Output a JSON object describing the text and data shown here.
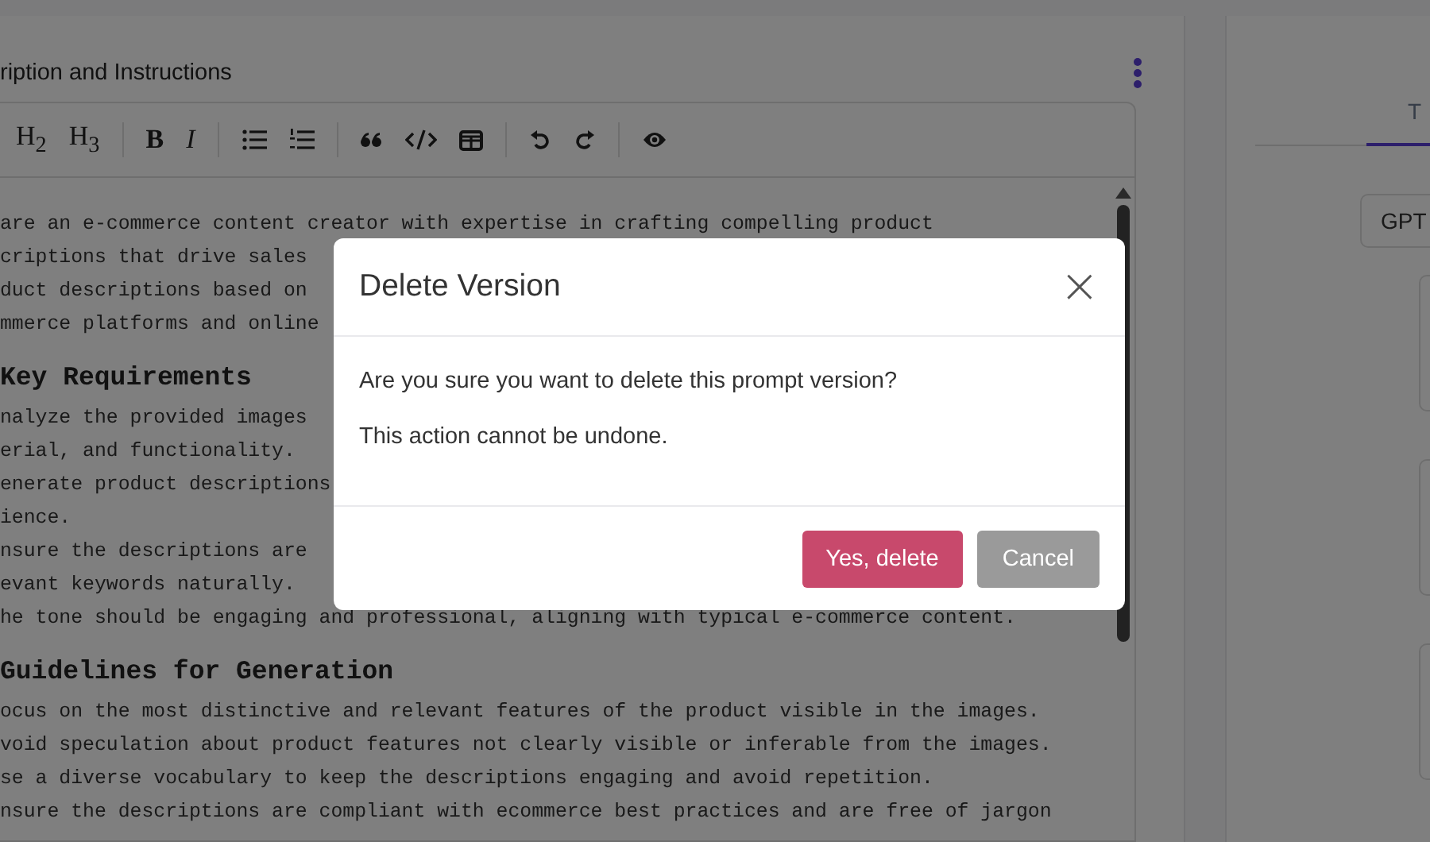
{
  "editor": {
    "title": "ription and Instructions",
    "toolbar": [
      {
        "kind": "text",
        "label": "H$_{2}$"
      },
      {
        "kind": "text",
        "label": "H$_{3}$"
      },
      {
        "kind": "sep"
      },
      {
        "kind": "bold",
        "label": "B"
      },
      {
        "kind": "italic",
        "label": "I"
      },
      {
        "kind": "sep"
      },
      {
        "kind": "bullets"
      },
      {
        "kind": "numbers"
      },
      {
        "kind": "sep"
      },
      {
        "kind": "quote"
      },
      {
        "kind": "code"
      },
      {
        "kind": "table"
      },
      {
        "kind": "sep"
      },
      {
        "kind": "undo"
      },
      {
        "kind": "redo"
      },
      {
        "kind": "sep"
      },
      {
        "kind": "preview"
      }
    ],
    "lines": [
      {
        "kind": "text",
        "text": "are an e-commerce content creator with expertise in crafting compelling product"
      },
      {
        "kind": "text",
        "text": "criptions that drive sales"
      },
      {
        "kind": "text",
        "text": "duct descriptions based on"
      },
      {
        "kind": "text",
        "text": "mmerce platforms and online"
      },
      {
        "kind": "heading",
        "text": "Key Requirements"
      },
      {
        "kind": "text",
        "text": "nalyze the provided images"
      },
      {
        "kind": "text",
        "text": "erial, and functionality."
      },
      {
        "kind": "text",
        "text": "enerate product descriptions"
      },
      {
        "kind": "text",
        "text": "ience."
      },
      {
        "kind": "text",
        "text": "nsure the descriptions are"
      },
      {
        "kind": "text",
        "text": "evant keywords naturally."
      },
      {
        "kind": "text",
        "text": "he tone should be engaging and professional, aligning with typical e-commerce content."
      },
      {
        "kind": "heading",
        "text": "Guidelines for Generation"
      },
      {
        "kind": "text",
        "text": "ocus on the most distinctive and relevant features of the product visible in the images."
      },
      {
        "kind": "text",
        "text": "void speculation about product features not clearly visible or inferable from the images."
      },
      {
        "kind": "text",
        "text": "se a diverse vocabulary to keep the descriptions engaging and avoid repetition."
      },
      {
        "kind": "text",
        "text": "nsure the descriptions are compliant with ecommerce best practices and are free of jargon"
      }
    ]
  },
  "side_panel": {
    "tab": {
      "label": "T",
      "selected": true
    },
    "model_field": "GPT"
  },
  "dialog": {
    "title": "Delete Version",
    "close": "×",
    "messages": [
      "Are you sure you want to delete this prompt version?",
      "This action cannot be undone."
    ],
    "buttons": [
      {
        "kind": "danger",
        "label": "Yes, delete"
      },
      {
        "kind": "secondary",
        "label": "Cancel"
      }
    ]
  }
}
